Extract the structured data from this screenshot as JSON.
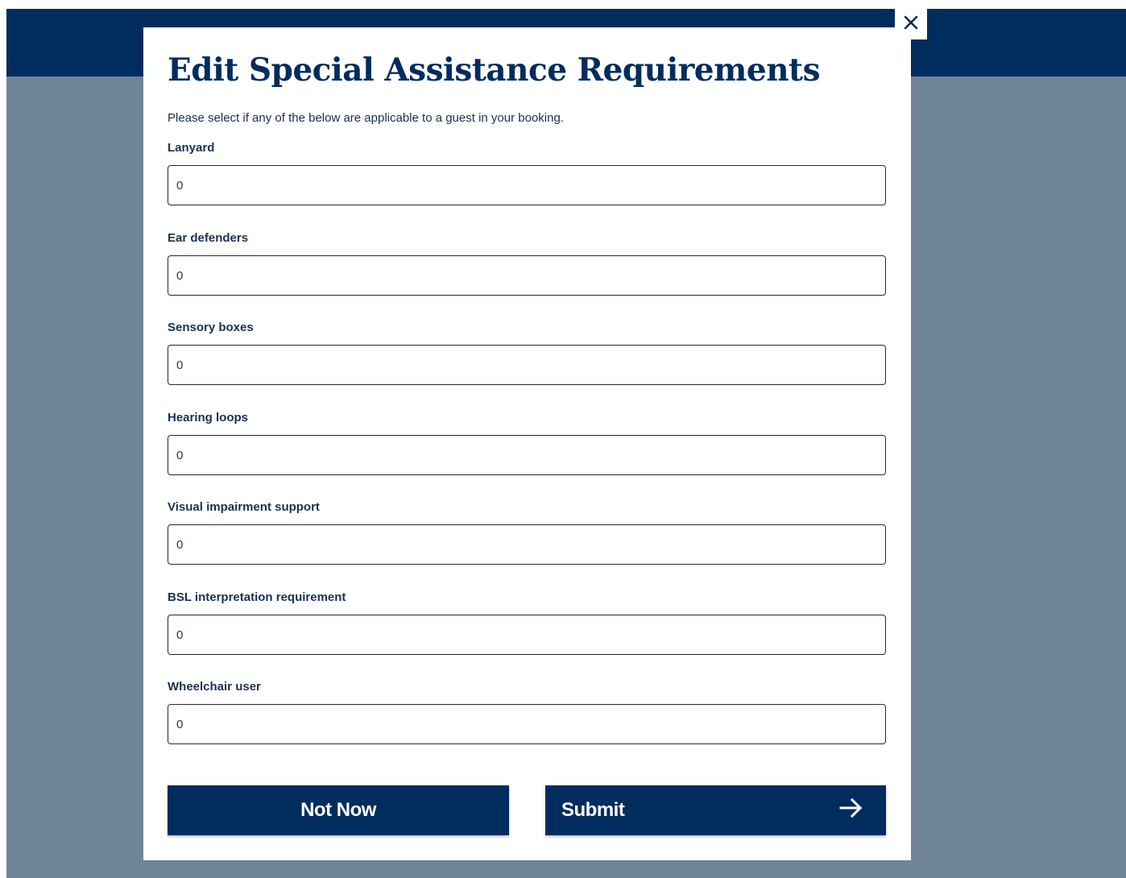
{
  "colors": {
    "header": "#002d5e",
    "backdrop": "#6f8499",
    "button": "#002d5e",
    "text": "#002d5e"
  },
  "modal": {
    "title": "Edit Special Assistance Requirements",
    "intro": "Please select if any of the below are applicable to a guest in your booking.",
    "close_icon": "close-icon"
  },
  "fields": [
    {
      "label": "Lanyard",
      "value": "0"
    },
    {
      "label": "Ear defenders",
      "value": "0"
    },
    {
      "label": "Sensory boxes",
      "value": "0"
    },
    {
      "label": "Hearing loops",
      "value": "0"
    },
    {
      "label": "Visual impairment support",
      "value": "0"
    },
    {
      "label": "BSL interpretation requirement",
      "value": "0"
    },
    {
      "label": "Wheelchair user",
      "value": "0"
    }
  ],
  "buttons": {
    "not_now": "Not Now",
    "submit": "Submit",
    "submit_icon": "arrow-right-icon"
  }
}
